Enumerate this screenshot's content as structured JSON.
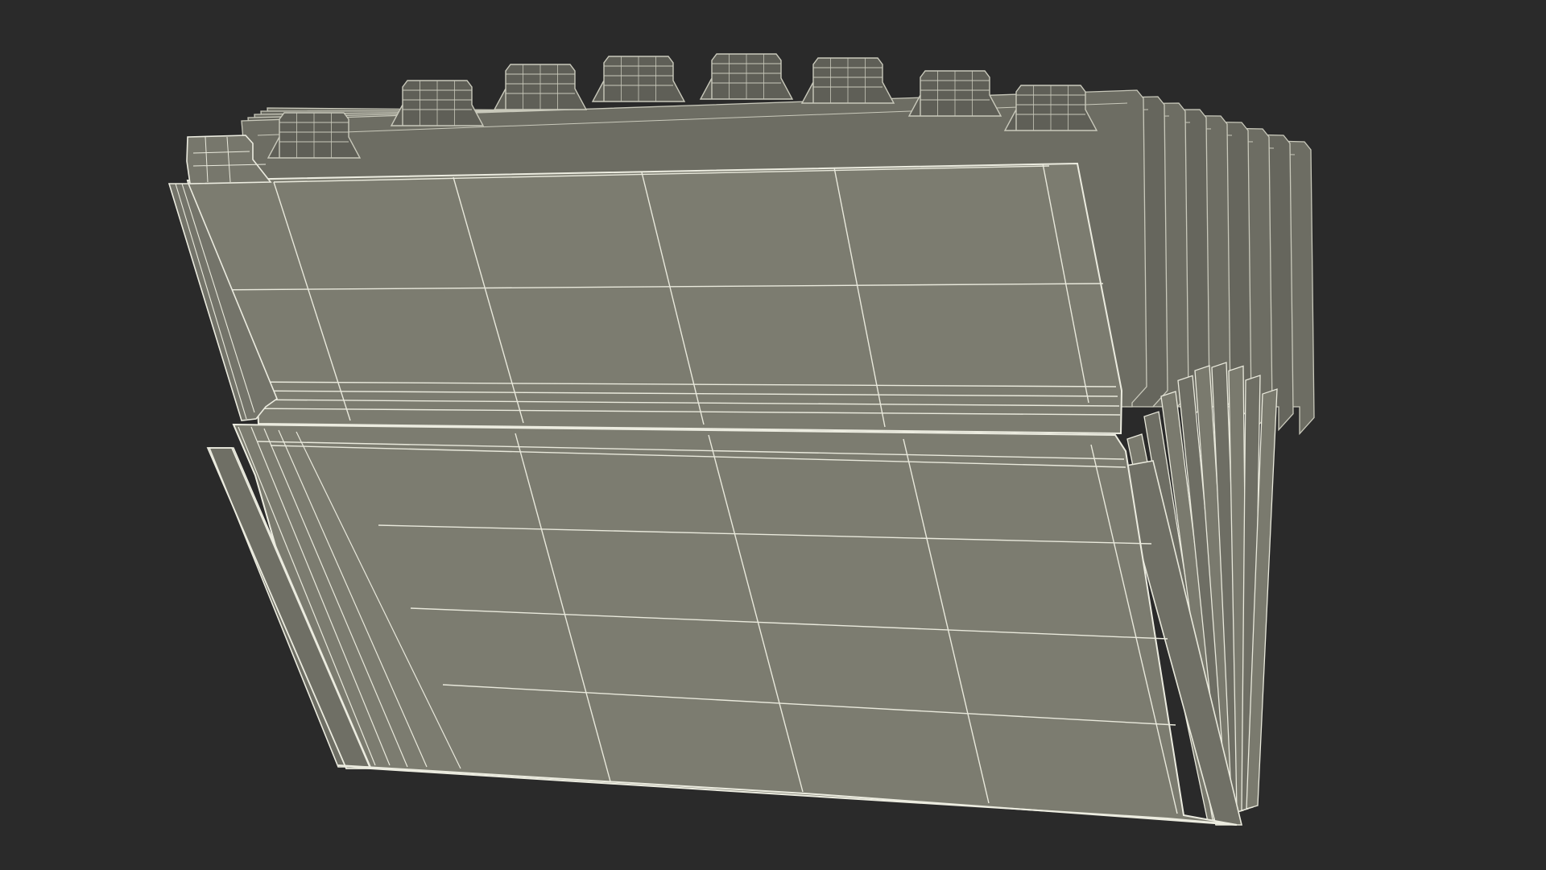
{
  "scene": {
    "subject": "accordion-file-folder-wireframe",
    "colors": {
      "background": "#2a2a2a",
      "surface": "#7c7c70",
      "surface_shadow": "#55554d",
      "wire": "#e9e9dc",
      "wire_dim": "#c9c9bb"
    },
    "divider_tab_count": 9,
    "back_divider_count": 9,
    "gusset_fold_count": 9
  }
}
